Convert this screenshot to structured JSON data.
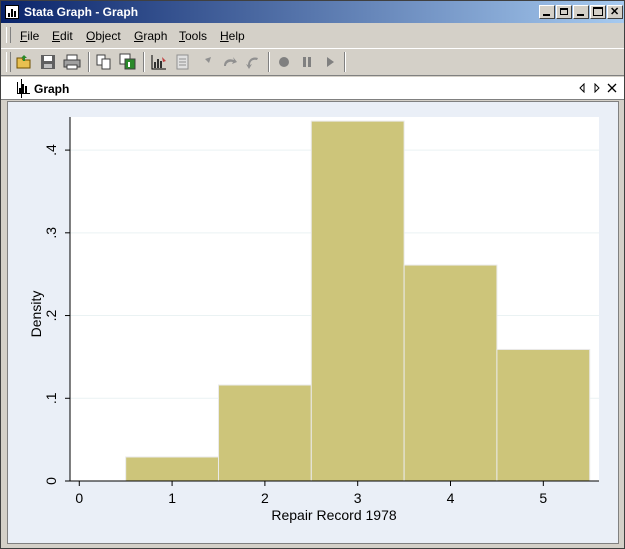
{
  "window": {
    "title": "Stata Graph - Graph"
  },
  "menu": [
    "File",
    "Edit",
    "Object",
    "Graph",
    "Tools",
    "Help"
  ],
  "toolbar": {
    "buttons": [
      "open-icon",
      "save-icon",
      "print-icon",
      "copy-icon",
      "copy-graph-icon",
      "graph-editor-icon",
      "record-icon",
      "pointer-icon",
      "rotate-icon",
      "grid-edit-icon",
      "play-record-icon",
      "pause-icon",
      "play-icon"
    ]
  },
  "tab": {
    "label": "Graph"
  },
  "colors": {
    "bar": "#cdc57a",
    "bar_edge": "#eaeaea",
    "plot_bg": "#ffffff",
    "outer_bg": "#eaeff7",
    "title_start": "#0a246a",
    "title_end": "#a6caf0"
  },
  "chart_data": {
    "type": "bar",
    "categories": [
      "1",
      "2",
      "3",
      "4",
      "5"
    ],
    "values": [
      0.029,
      0.116,
      0.435,
      0.261,
      0.159
    ],
    "xlabel": "Repair Record 1978",
    "ylabel": "Density",
    "xticks": [
      "0",
      "1",
      "2",
      "3",
      "4",
      "5"
    ],
    "yticks": [
      "0",
      ".1",
      ".2",
      ".3",
      ".4"
    ],
    "xlim": [
      -0.1,
      5.6
    ],
    "ylim": [
      0,
      0.44
    ],
    "grid": true
  }
}
